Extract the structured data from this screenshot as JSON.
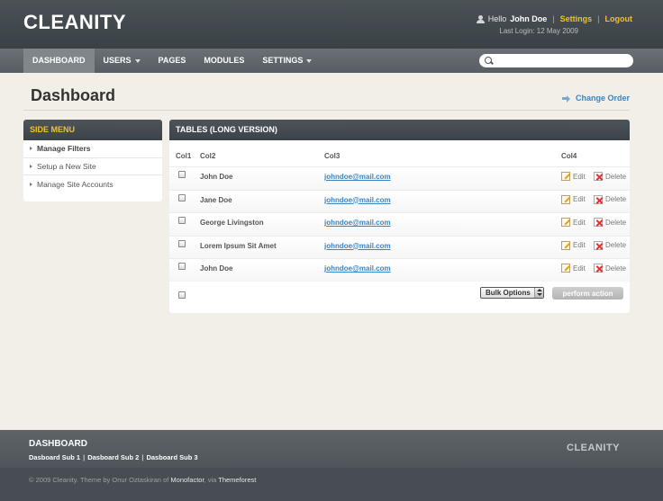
{
  "header": {
    "logo": "CLEANITY",
    "greeting": "Hello",
    "username": "John Doe",
    "settings_link": "Settings",
    "logout_link": "Logout",
    "separator": "|",
    "last_login": "Last Login: 12 May 2009"
  },
  "nav": {
    "items": [
      {
        "label": "DASHBOARD",
        "active": true,
        "dropdown": false
      },
      {
        "label": "USERS",
        "active": false,
        "dropdown": true
      },
      {
        "label": "PAGES",
        "active": false,
        "dropdown": false
      },
      {
        "label": "MODULES",
        "active": false,
        "dropdown": false
      },
      {
        "label": "SETTINGS",
        "active": false,
        "dropdown": true
      }
    ],
    "search_value": ""
  },
  "page": {
    "title": "Dashboard",
    "change_order": "Change Order"
  },
  "side_menu": {
    "title": "SIDE MENU",
    "items": [
      "Manage Filters",
      "Setup a New Site",
      "Manage Site Accounts"
    ]
  },
  "table": {
    "title": "TABLES (LONG VERSION)",
    "columns": [
      "Col1",
      "Col2",
      "Col3",
      "Col4"
    ],
    "rows": [
      {
        "name": "John Doe",
        "email": "johndoe@mail.com"
      },
      {
        "name": "Jane Doe",
        "email": "johndoe@mail.com"
      },
      {
        "name": "George Livingston",
        "email": "johndoe@mail.com"
      },
      {
        "name": "Lorem Ipsum Sit Amet",
        "email": "johndoe@mail.com"
      },
      {
        "name": "John Doe",
        "email": "johndoe@mail.com"
      }
    ],
    "edit_label": "Edit",
    "delete_label": "Delete",
    "bulk_options": "Bulk Options",
    "perform_action": "perform action"
  },
  "footer": {
    "title": "DASHBOARD",
    "subs": [
      "Dasboard Sub 1",
      "Dasboard Sub 2",
      "Dasboard Sub 3"
    ],
    "separator": "|",
    "logo": "CLEANITY",
    "copyright_prefix": "© 2009 Cleanity. Theme by Onur Oztaskiran of",
    "company": "Monofactor",
    "via": ", via",
    "marketplace": "Themeforest"
  }
}
